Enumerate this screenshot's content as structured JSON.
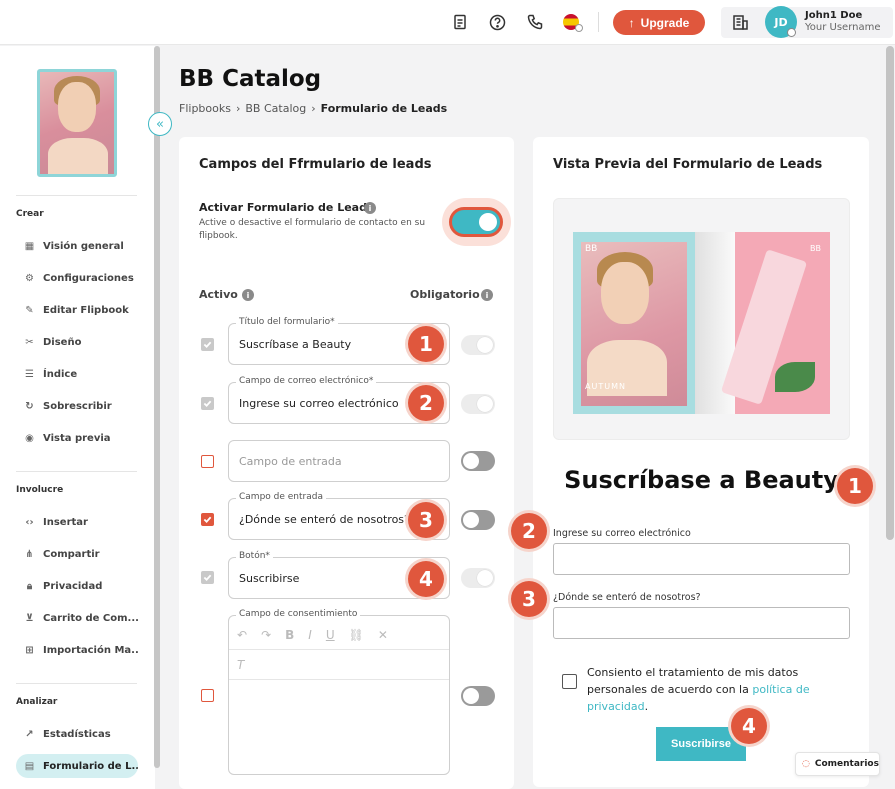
{
  "topbar": {
    "upgrade_label": "Upgrade",
    "user_initials": "JD",
    "user_name": "John1 Doe",
    "user_handle": "Your Username"
  },
  "sidebar": {
    "sections": [
      {
        "title": "Crear",
        "items": [
          {
            "label": "Visión general",
            "icon": "layout-icon"
          },
          {
            "label": "Configuraciones",
            "icon": "gear-icon"
          },
          {
            "label": "Editar Flipbook",
            "icon": "pencil-icon"
          },
          {
            "label": "Diseño",
            "icon": "palette-icon"
          },
          {
            "label": "Índice",
            "icon": "list-icon"
          },
          {
            "label": "Sobrescribir",
            "icon": "refresh-icon"
          },
          {
            "label": "Vista previa",
            "icon": "eye-icon"
          }
        ]
      },
      {
        "title": "Involucre",
        "items": [
          {
            "label": "Insertar",
            "icon": "code-icon"
          },
          {
            "label": "Compartir",
            "icon": "share-icon"
          },
          {
            "label": "Privacidad",
            "icon": "lock-icon"
          },
          {
            "label": "Carrito de Com...",
            "icon": "cart-icon"
          },
          {
            "label": "Importación Ma...",
            "icon": "import-icon"
          }
        ]
      },
      {
        "title": "Analizar",
        "items": [
          {
            "label": "Estadísticas",
            "icon": "trend-icon"
          },
          {
            "label": "Formulario de L...",
            "icon": "form-icon",
            "active": true
          }
        ]
      }
    ]
  },
  "header": {
    "title": "BB Catalog",
    "breadcrumb": [
      "Flipbooks",
      "BB Catalog",
      "Formulario de Leads"
    ]
  },
  "left_card": {
    "title": "Campos del Ffrmulario de leads",
    "activate_title": "Activar Formulario de Leads",
    "activate_desc": "Active o desactive el formulario de contacto en su flipbook.",
    "activate_on": true,
    "col_active": "Activo",
    "col_required": "Obligatorio",
    "fields": [
      {
        "label": "Título del formulario*",
        "value": "Suscríbase a Beauty",
        "check": "gray",
        "toggle": "disabled",
        "badge": "1"
      },
      {
        "label": "Campo de correo electrónico*",
        "value": "Ingrese su correo electrónico",
        "check": "gray",
        "toggle": "disabled",
        "badge": "2"
      },
      {
        "label": "",
        "placeholder": "Campo de entrada",
        "check": "empty",
        "toggle": "off",
        "badge": ""
      },
      {
        "label": "Campo de entrada",
        "value": "¿Dónde se enteró de nosotros?",
        "check": "red",
        "toggle": "off",
        "badge": "3"
      },
      {
        "label": "Botón*",
        "value": "Suscribirse",
        "check": "gray",
        "toggle": "disabled",
        "badge": "4"
      }
    ],
    "consent_label": "Campo de consentimiento",
    "consent_check": "empty",
    "consent_toggle": "off"
  },
  "right_card": {
    "title": "Vista Previa del Formulario de Leads",
    "cover_brand": "BB",
    "cover_text": "AUTUMN",
    "form_title": "Suscríbase a Beauty",
    "email_label": "Ingrese su correo electrónico",
    "question_label": "¿Dónde se enteró de nosotros?",
    "consent_text": "Consiento el tratamiento de mis datos personales de acuerdo con la",
    "consent_link": "política de privacidad",
    "consent_end": ".",
    "submit_label": "Suscribirse",
    "badges": [
      "1",
      "2",
      "3",
      "4"
    ]
  },
  "feedback_label": "Comentarios",
  "colors": {
    "accent": "#e0573d",
    "teal": "#3fb8c4"
  }
}
